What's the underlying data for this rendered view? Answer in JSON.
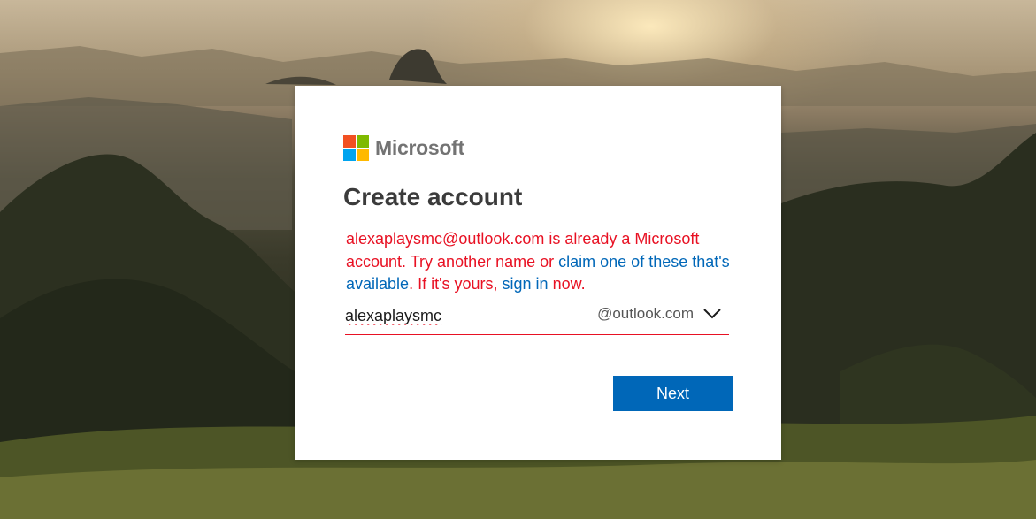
{
  "brand": {
    "name": "Microsoft",
    "logo_colors": [
      "#f25022",
      "#7fba00",
      "#00a4ef",
      "#ffb900"
    ]
  },
  "form": {
    "title": "Create account",
    "error": {
      "seg1": "alexaplaysmc@outlook.com is already a Microsoft account. Try another name or ",
      "claim_link": "claim one of these that's available",
      "seg2": ". If it's yours, ",
      "signin_link": "sign in",
      "seg3": " now."
    },
    "username_value": "alexaplaysmc",
    "domain_selected": "@outlook.com",
    "next_label": "Next"
  },
  "colors": {
    "error": "#e81123",
    "link": "#0067b8",
    "button": "#0067b8"
  }
}
